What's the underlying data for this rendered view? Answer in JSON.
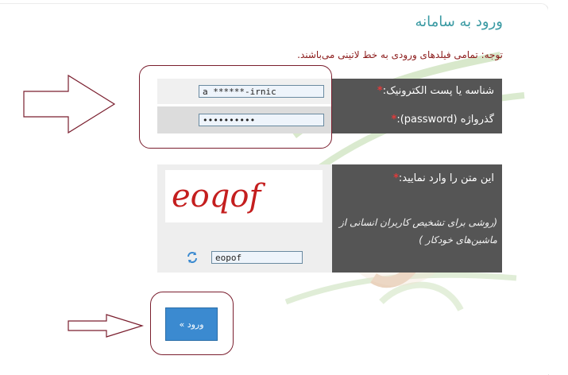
{
  "title": "ورود به سامانه",
  "note_prefix": "توجه:",
  "note_text": " تمامی فیلدهای ورودی به خط لاتینی می‌باشند.",
  "fields": {
    "email_label": "شناسه یا پست الکترونیک:",
    "email_value": "a ******-irnic",
    "password_label": "گذرواژه (password):",
    "password_value": "••••••••••",
    "required_marker": "*"
  },
  "captcha": {
    "label": "این متن را وارد نمایید:",
    "hint": "(روشی برای تشخیص کاربران انسانی از ماشین‌های خودکار )",
    "image_text": "eoqof",
    "value": "eopof",
    "refresh_icon": "refresh-icon"
  },
  "submit_label": "ورود »",
  "colors": {
    "title": "#3a9aa3",
    "note": "#8b1a1a",
    "label_bg": "#555555",
    "button": "#3b8ad0",
    "ring": "#7a1e2e",
    "captcha_text": "#c41e1e"
  }
}
